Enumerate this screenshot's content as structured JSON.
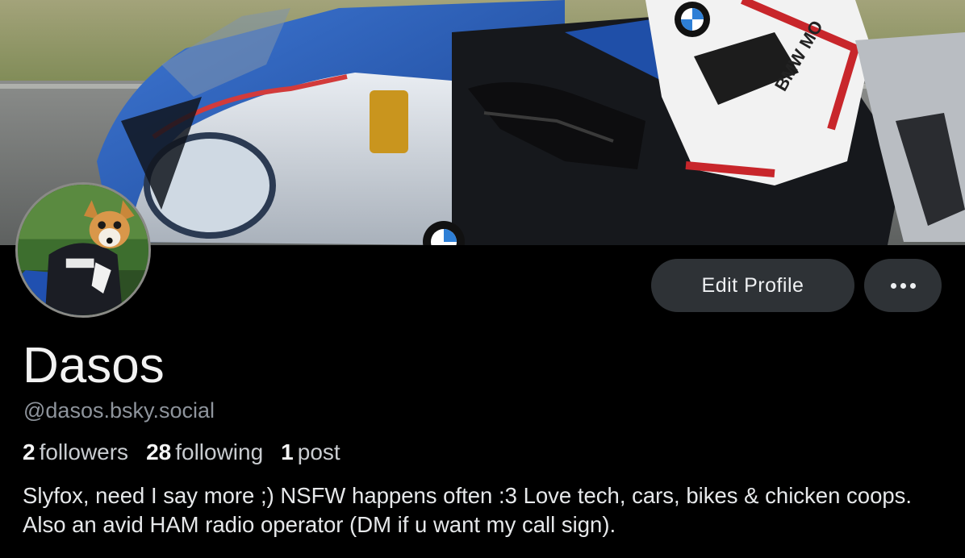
{
  "profile": {
    "display_name": "Dasos",
    "handle": "@dasos.bsky.social",
    "bio": "Slyfox, need I say more ;) NSFW happens often :3 Love tech, cars, bikes & chicken coops. Also an avid HAM radio operator (DM if u want my call sign).",
    "stats": {
      "followers_count": "2",
      "followers_label": "followers",
      "following_count": "28",
      "following_label": "following",
      "posts_count": "1",
      "posts_label": "post"
    }
  },
  "actions": {
    "edit_profile_label": "Edit Profile",
    "more_icon": "ellipsis-icon"
  },
  "banner": {
    "suit_text": "BMW MO"
  },
  "colors": {
    "background": "#000000",
    "button_bg": "#2e3236",
    "handle_text": "#8e949c",
    "bike_blue": "#1f4fa8"
  }
}
